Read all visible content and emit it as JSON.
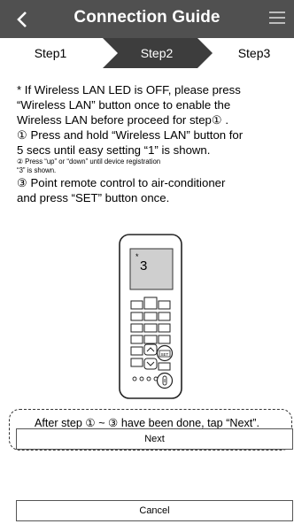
{
  "header": {
    "title": "Connection Guide",
    "back_icon": "chevron-left-icon",
    "menu_icon": "hamburger-menu-icon",
    "bg_color": "#505050"
  },
  "steps": [
    {
      "label": "Step1",
      "active": false
    },
    {
      "label": "Step2",
      "active": true
    },
    {
      "label": "Step3",
      "active": false
    }
  ],
  "instructions": {
    "line1": "* If Wireless LAN LED is OFF, please press",
    "line2": "“Wireless LAN” button once to enable the",
    "line3": "Wireless LAN before proceed for step① .",
    "line4": "① Press and hold “Wireless LAN” button for",
    "line5": "5 secs until easy setting “1” is shown.",
    "line6": "② Press “up” or “down” until device registration",
    "line7": "“3” is shown.",
    "line8": "③ Point remote control to air-conditioner",
    "line9": "and press “SET” button once."
  },
  "remote": {
    "display_digit": "3",
    "button_set_label": "SET",
    "button_up_icon": "up-arrow-icon",
    "button_down_icon": "down-arrow-icon"
  },
  "footer": {
    "hint": "After step ① ~ ③  have been done, tap “Next”.",
    "next_label": "Next",
    "cancel_label": "Cancel"
  }
}
